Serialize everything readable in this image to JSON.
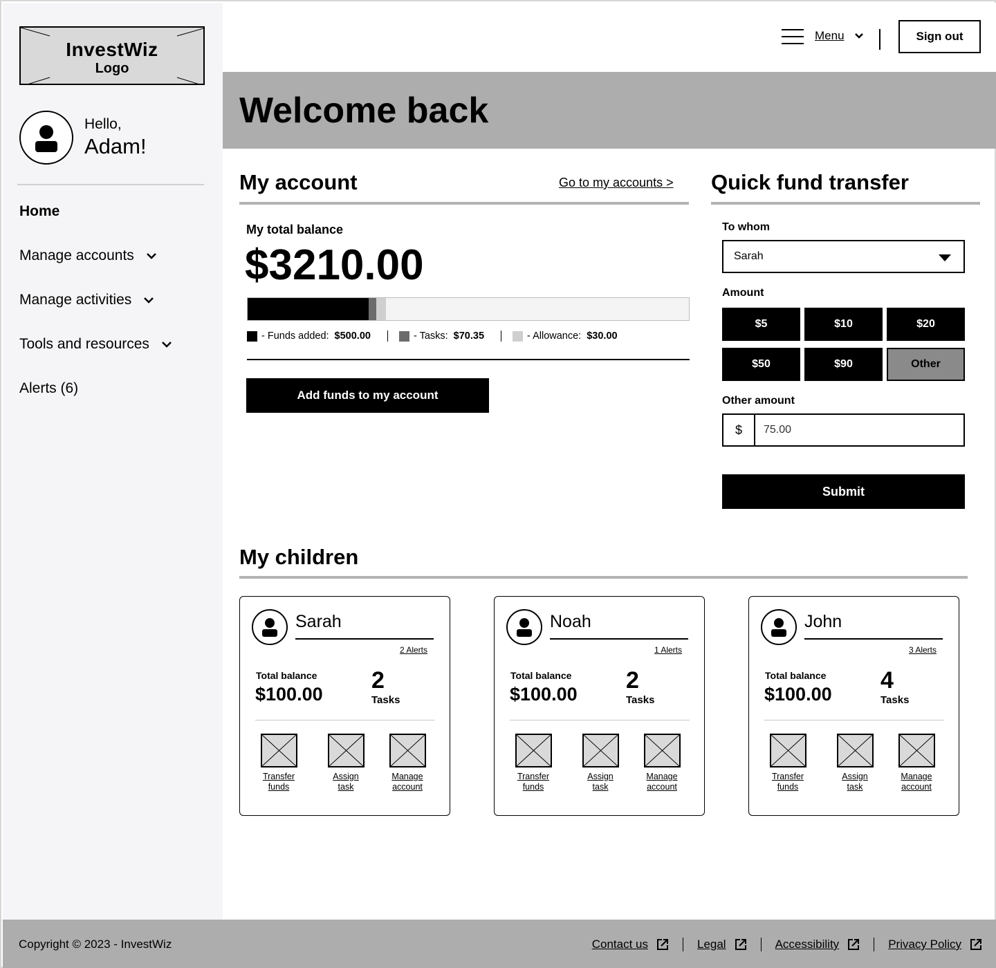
{
  "logo": {
    "title": "InvestWiz",
    "subtitle": "Logo"
  },
  "user": {
    "greeting": "Hello,",
    "name": "Adam!"
  },
  "nav": {
    "home": "Home",
    "manage_accounts": "Manage accounts",
    "manage_activities": "Manage activities",
    "tools": "Tools and resources",
    "alerts": "Alerts (6)"
  },
  "header": {
    "menu": "Menu",
    "signout": "Sign out"
  },
  "hero": {
    "title": "Welcome back"
  },
  "account": {
    "title": "My account",
    "link": "Go to my accounts >",
    "balance_label": "My total balance",
    "balance": "$3210.00",
    "breakdown": [
      {
        "label": "- Funds added:",
        "value": "$500.00",
        "color": "#000000",
        "fraction": 0.275
      },
      {
        "label": "- Tasks:",
        "value": "$70.35",
        "color": "#6b6b6b",
        "fraction": 0.018
      },
      {
        "label": "- Allowance:",
        "value": "$30.00",
        "color": "#cfcfcf",
        "fraction": 0.022
      }
    ],
    "add_funds": "Add funds to my account"
  },
  "transfer": {
    "title": "Quick fund transfer",
    "to_label": "To whom",
    "to_value": "Sarah",
    "amount_label": "Amount",
    "amounts": [
      "$5",
      "$10",
      "$20",
      "$50",
      "$90",
      "Other"
    ],
    "other_label": "Other amount",
    "currency": "$",
    "other_value": "75.00",
    "submit": "Submit"
  },
  "children": {
    "title": "My children",
    "list": [
      {
        "name": "Sarah",
        "alerts": "2 Alerts",
        "balance_label": "Total balance",
        "balance": "$100.00",
        "tasks": "2",
        "tasks_label": "Tasks"
      },
      {
        "name": "Noah",
        "alerts": "1 Alerts",
        "balance_label": "Total balance",
        "balance": "$100.00",
        "tasks": "2",
        "tasks_label": "Tasks"
      },
      {
        "name": "John",
        "alerts": "3 Alerts",
        "balance_label": "Total balance",
        "balance": "$100.00",
        "tasks": "4",
        "tasks_label": "Tasks"
      }
    ],
    "actions": [
      {
        "line1": "Transfer",
        "line2": "funds"
      },
      {
        "line1": "Assign",
        "line2": "task"
      },
      {
        "line1": "Manage",
        "line2": "account"
      }
    ]
  },
  "footer": {
    "copyright": "Copyright © 2023 - InvestWiz",
    "links": [
      "Contact us",
      "Legal",
      "Accessibility",
      "Privacy Policy"
    ]
  }
}
